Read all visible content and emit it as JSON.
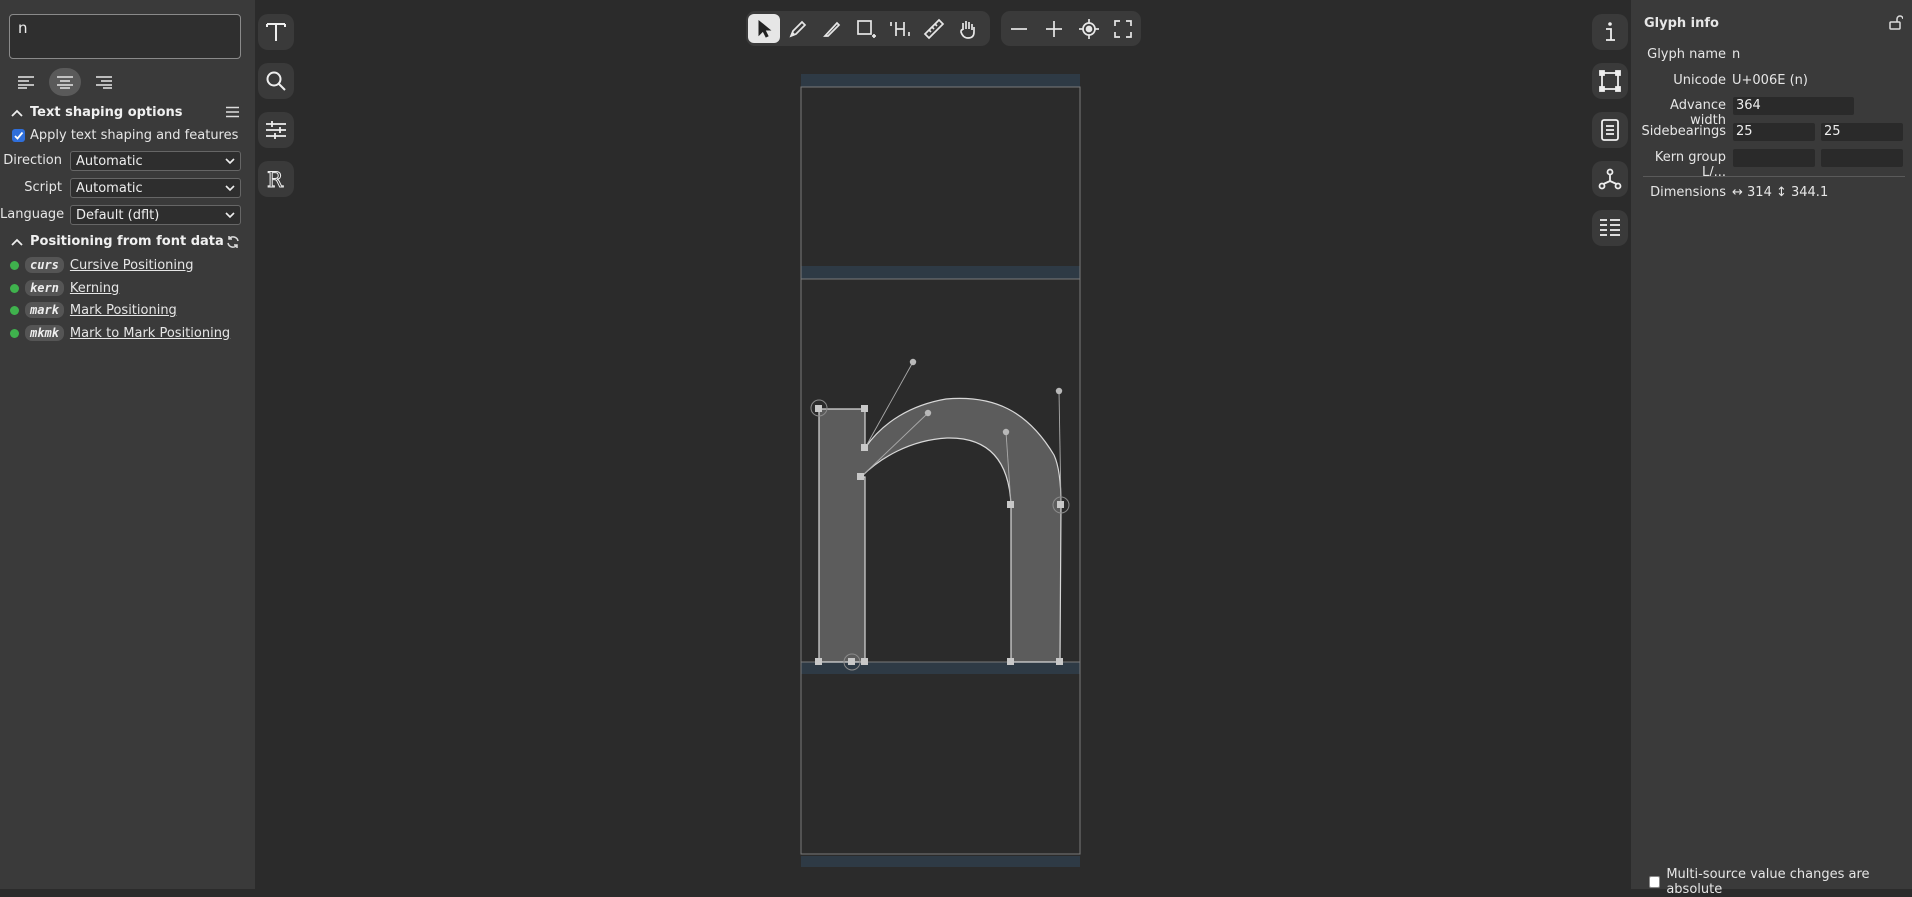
{
  "left_panel": {
    "text_input_value": "n",
    "shaping_section_title": "Text shaping options",
    "apply_shaping_label": "Apply text shaping and features",
    "direction_label": "Direction",
    "direction_value": "Automatic",
    "script_label": "Script",
    "script_value": "Automatic",
    "language_label": "Language",
    "language_value": "Default (dflt)",
    "positioning_section_title": "Positioning from font data",
    "features": [
      {
        "tag": "curs",
        "name": "Cursive Positioning",
        "enabled": true
      },
      {
        "tag": "kern",
        "name": "Kerning",
        "enabled": true
      },
      {
        "tag": "mark",
        "name": "Mark Positioning",
        "enabled": true
      },
      {
        "tag": "mkmk",
        "name": "Mark to Mark Positioning",
        "enabled": true
      }
    ]
  },
  "side_tools": [
    "text-tool",
    "search-tool",
    "sliders-tool",
    "references-tool"
  ],
  "toolbar": {
    "active_tool": "pointer",
    "tools": [
      "pointer",
      "pen",
      "knife",
      "shape",
      "power-ruler",
      "ruler",
      "hand"
    ],
    "view": [
      "zoom-out",
      "zoom-in",
      "zoom-fit",
      "fullscreen"
    ]
  },
  "glyph_info": {
    "title": "Glyph info",
    "glyph_name_label": "Glyph name",
    "glyph_name_value": "n",
    "unicode_label": "Unicode",
    "unicode_value": "U+006E (n)",
    "advance_width_label": "Advance width",
    "advance_width_value": "364",
    "sidebearings_label": "Sidebearings",
    "sidebearing_left": "25",
    "sidebearing_right": "25",
    "kern_group_label": "Kern group L/...",
    "kern_group_left": "",
    "kern_group_right": "",
    "dimensions_label": "Dimensions",
    "dimensions_value": "↔ 314 ↕ 344.1",
    "multi_source_label": "Multi-source value changes are absolute"
  },
  "colors": {
    "background": "#2b2b2b",
    "panel": "#3a3a3a",
    "accent_green": "#3fb24d",
    "metric_band": "#2e3a45"
  }
}
